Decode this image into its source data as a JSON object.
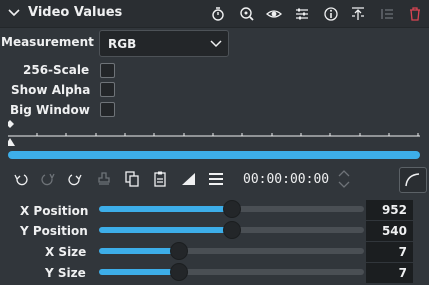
{
  "header": {
    "title": "Video Values",
    "icons": [
      "collapse-chevron-icon",
      "timer-icon",
      "zoom-icon",
      "eye-icon",
      "sliders-icon",
      "info-icon",
      "align-top-icon",
      "list-icon",
      "trash-icon"
    ]
  },
  "params": {
    "measurement_label": "Measurement",
    "measurement_value": "RGB",
    "scale256_label": "256-Scale",
    "show_alpha_label": "Show Alpha",
    "big_window_label": "Big Window",
    "scale256_checked": false,
    "show_alpha_checked": false,
    "big_window_checked": false
  },
  "timeline": {
    "timecode": "00:00:00:00",
    "progress_fraction": 1.0
  },
  "sliders": [
    {
      "label": "X Position",
      "value": "952",
      "fraction": 0.5
    },
    {
      "label": "Y Position",
      "value": "540",
      "fraction": 0.5
    },
    {
      "label": "X Size",
      "value": "7",
      "fraction": 0.3
    },
    {
      "label": "Y Size",
      "value": "7",
      "fraction": 0.3
    }
  ],
  "colors": {
    "accent": "#3daee9",
    "background": "#31363b",
    "header": "#2a2e32",
    "delete": "#da4453"
  }
}
